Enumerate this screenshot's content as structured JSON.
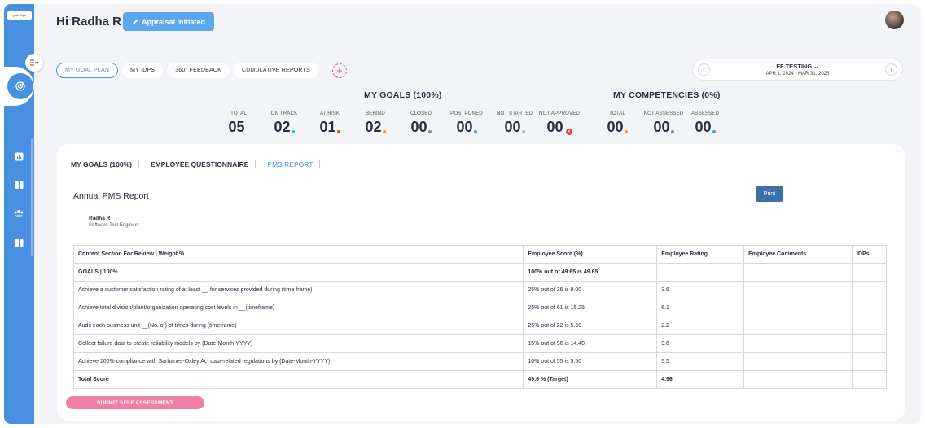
{
  "brand": {
    "logo_text": "your logo",
    "accent": "#4a90e2",
    "pink": "#ee7fa8"
  },
  "header": {
    "greeting": "Hi Radha R",
    "status": "Appraisal Initiated"
  },
  "tabs": [
    {
      "label": "MY GOAL PLAN",
      "active": true
    },
    {
      "label": "MY IDPS",
      "active": false
    },
    {
      "label": "360° FEEDBACK",
      "active": false
    },
    {
      "label": "CUMULATIVE REPORTS",
      "active": false
    }
  ],
  "period": {
    "title": "FF TESTING",
    "range": "APR 1, 2024 - MAR 31, 2025"
  },
  "goals": {
    "title": "MY GOALS (100%)",
    "stats": [
      {
        "label": "TOTAL",
        "value": "05",
        "dot": "#ffffff"
      },
      {
        "label": "ON TRACK",
        "value": "02",
        "dot": "#2ecc71"
      },
      {
        "label": "AT RISK",
        "value": "01",
        "dot": "#e74c3c"
      },
      {
        "label": "BEHIND",
        "value": "02",
        "dot": "#f39c12"
      },
      {
        "label": "CLOSED",
        "value": "00",
        "dot": "#888888"
      },
      {
        "label": "POSTPONED",
        "value": "00",
        "dot": "#4a90e2"
      },
      {
        "label": "NOT STARTED",
        "value": "00",
        "dot": "#bbbbbb"
      },
      {
        "label": "NOT APPROVED",
        "value": "00",
        "dot": "x"
      }
    ]
  },
  "competencies": {
    "title": "MY COMPETENCIES (0%)",
    "stats": [
      {
        "label": "TOTAL",
        "value": "00",
        "dot": "#f39c12"
      },
      {
        "label": "NOT ASSESSED",
        "value": "00",
        "dot": "#888888"
      },
      {
        "label": "ASSESSED",
        "value": "00",
        "dot": "#4a90e2"
      }
    ]
  },
  "subtabs": [
    {
      "label": "MY GOALS (100%)",
      "active": false
    },
    {
      "label": "EMPLOYEE QUESTIONNAIRE",
      "active": false
    },
    {
      "label": "PMS REPORT",
      "active": true
    }
  ],
  "report": {
    "title": "Annual PMS Report",
    "print_label": "Print",
    "employee_name": "Radha R",
    "employee_role": "Software Test Engineer",
    "columns": [
      "Content Section For Review | Weight %",
      "Employee Score (%)",
      "Employee Rating",
      "Employee Comments",
      "IDPs"
    ],
    "rows": [
      {
        "bold": true,
        "cells": [
          "GOALS | 100%",
          "100% out of 49.65 is 49.65",
          "",
          "",
          ""
        ]
      },
      {
        "bold": false,
        "cells": [
          "Achieve a customer satisfaction rating of at least __ for services provided during (time frame)",
          "25% out of 36 is 9.00",
          "3.6",
          "",
          ""
        ]
      },
      {
        "bold": false,
        "cells": [
          "Achieve total division/plant/organization operating cost levels in __(timeframe)",
          "25% out of 61 is 15.25",
          "6.1",
          "",
          ""
        ]
      },
      {
        "bold": false,
        "cells": [
          "Audit each business unit __(No. of) of times during (timeframe)",
          "25% out of 22 is 5.50",
          "2.2",
          "",
          ""
        ]
      },
      {
        "bold": false,
        "cells": [
          "Collect failure data to create reliability models by (Date-Month-YYYY)",
          "15% out of 96 is 14.40",
          "9.6",
          "",
          ""
        ]
      },
      {
        "bold": false,
        "cells": [
          "Achieve 100% compliance with Sarbanes-Oxley Act data-related regulations by (Date-Month-YYYY)",
          "10% out of 55 is 5.50",
          "5.5",
          "",
          ""
        ]
      },
      {
        "bold": true,
        "cells": [
          "Total Score",
          "49.6 % (Target)",
          "4.96",
          "",
          ""
        ]
      }
    ]
  },
  "submit_label": "SUBMIT SELF ASSESSMENT"
}
